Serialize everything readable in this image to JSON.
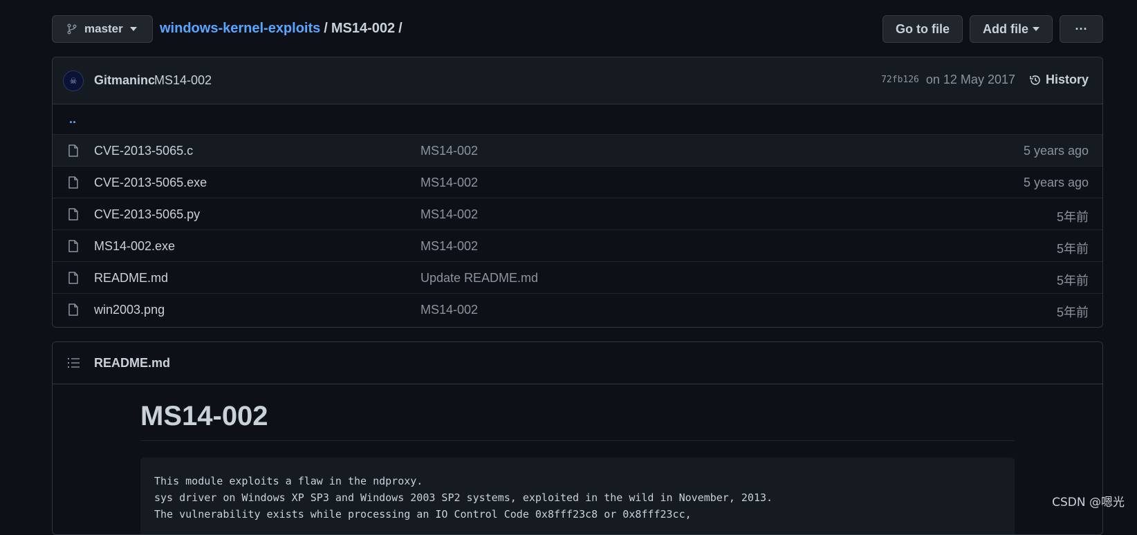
{
  "branch": {
    "label": "master"
  },
  "breadcrumb": {
    "repo": "windows-kernel-exploits",
    "folder": "MS14-002",
    "sep": "/"
  },
  "actions": {
    "goto_file": "Go to file",
    "add_file": "Add file",
    "more": "···"
  },
  "commit": {
    "author": "Gitmaninc",
    "message": "MS14-002",
    "sha": "72fb126",
    "date": "on 12 May 2017",
    "history_label": "History"
  },
  "parent_dir": "..",
  "files": [
    {
      "name": "CVE-2013-5065.c",
      "message": "MS14-002",
      "age": "5 years ago"
    },
    {
      "name": "CVE-2013-5065.exe",
      "message": "MS14-002",
      "age": "5 years ago"
    },
    {
      "name": "CVE-2013-5065.py",
      "message": "MS14-002",
      "age": "5年前"
    },
    {
      "name": "MS14-002.exe",
      "message": "MS14-002",
      "age": "5年前"
    },
    {
      "name": "README.md",
      "message": "Update README.md",
      "age": "5年前"
    },
    {
      "name": "win2003.png",
      "message": "MS14-002",
      "age": "5年前"
    }
  ],
  "readme": {
    "filename": "README.md",
    "heading": "MS14-002",
    "code_lines": [
      "This module exploits a flaw in the ndproxy.",
      "sys driver on Windows XP SP3 and Windows 2003 SP2 systems, exploited in the wild in November, 2013.",
      "The vulnerability exists while processing an IO Control Code 0x8fff23c8 or 0x8fff23cc,"
    ]
  },
  "watermark": "CSDN @嗯光"
}
